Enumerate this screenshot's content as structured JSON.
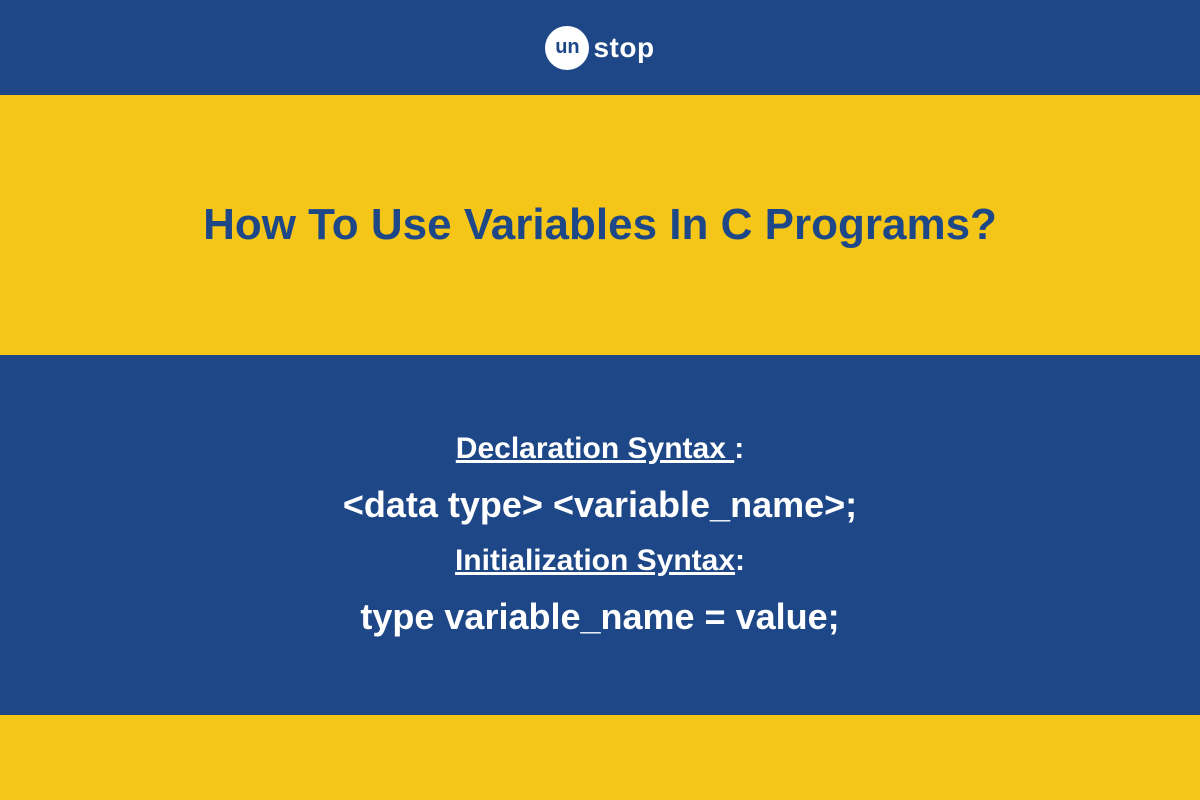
{
  "logo": {
    "circle_text": "un",
    "suffix_text": "stop"
  },
  "title": "How To Use Variables In C Programs?",
  "sections": {
    "declaration": {
      "label": "Declaration Syntax ",
      "colon": ":",
      "code": "<data type> <variable_name>;"
    },
    "initialization": {
      "label": "Initialization Syntax",
      "colon": ":",
      "code": "type variable_name = value;"
    }
  },
  "colors": {
    "primary_blue": "#1e4788",
    "accent_yellow": "#f5c518",
    "white": "#ffffff"
  }
}
